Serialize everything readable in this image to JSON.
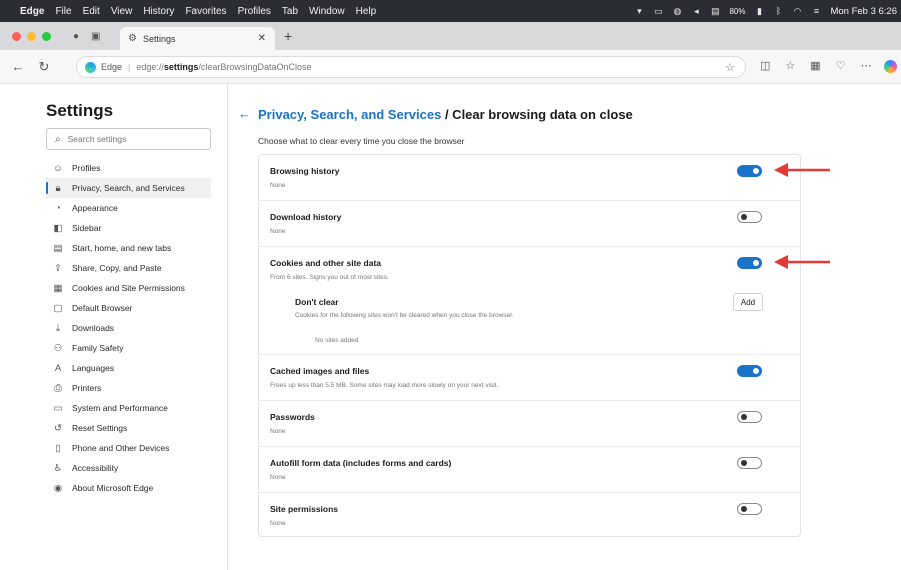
{
  "menubar": {
    "app": "Edge",
    "items": [
      "File",
      "Edit",
      "View",
      "History",
      "Favorites",
      "Profiles",
      "Tab",
      "Window",
      "Help"
    ],
    "battery": "80%",
    "clock": "Mon Feb 3 6:26"
  },
  "tab": {
    "title": "Settings"
  },
  "address": {
    "scheme_label": "Edge",
    "url_host": "edge://",
    "url_bold": "settings",
    "url_rest": "/clearBrowsingDataOnClose"
  },
  "sidebar": {
    "title": "Settings",
    "search_placeholder": "Search settings",
    "items": [
      {
        "label": "Profiles"
      },
      {
        "label": "Privacy, Search, and Services"
      },
      {
        "label": "Appearance"
      },
      {
        "label": "Sidebar"
      },
      {
        "label": "Start, home, and new tabs"
      },
      {
        "label": "Share, Copy, and Paste"
      },
      {
        "label": "Cookies and Site Permissions"
      },
      {
        "label": "Default Browser"
      },
      {
        "label": "Downloads"
      },
      {
        "label": "Family Safety"
      },
      {
        "label": "Languages"
      },
      {
        "label": "Printers"
      },
      {
        "label": "System and Performance"
      },
      {
        "label": "Reset Settings"
      },
      {
        "label": "Phone and Other Devices"
      },
      {
        "label": "Accessibility"
      },
      {
        "label": "About Microsoft Edge"
      }
    ]
  },
  "main": {
    "breadcrumb_link": "Privacy, Search, and Services",
    "breadcrumb_current": "/ Clear browsing data on close",
    "subtitle": "Choose what to clear every time you close the browser",
    "rows": [
      {
        "title": "Browsing history",
        "desc": "None",
        "state": "on"
      },
      {
        "title": "Download history",
        "desc": "None",
        "state": "off"
      },
      {
        "title": "Cookies and other site data",
        "desc": "From 6 sites. Signs you out of most sites.",
        "state": "on"
      },
      {
        "title": "Cached images and files",
        "desc": "Frees up less than 5.5 MB. Some sites may load more slowly on your next visit.",
        "state": "on"
      },
      {
        "title": "Passwords",
        "desc": "None",
        "state": "off"
      },
      {
        "title": "Autofill form data (includes forms and cards)",
        "desc": "None",
        "state": "off"
      },
      {
        "title": "Site permissions",
        "desc": "None",
        "state": "off"
      }
    ],
    "dont_clear": {
      "title": "Don't clear",
      "desc": "Cookies for the following sites won't be cleared when you close the browser.",
      "empty": "No sites added",
      "add_label": "Add"
    }
  },
  "colors": {
    "accent": "#1a73c7",
    "annotation_arrow": "#e53935"
  }
}
